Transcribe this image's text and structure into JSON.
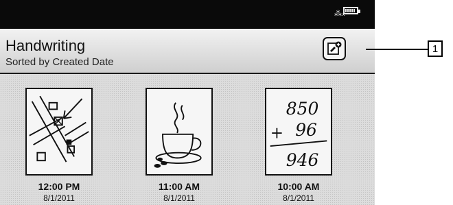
{
  "status_bar": {
    "wifi_icon": "wifi-off-icon",
    "battery_icon": "battery-icon"
  },
  "header": {
    "title": "Handwriting",
    "subtitle": "Sorted by Created Date",
    "new_note_icon": "new-handwriting-icon"
  },
  "callout": {
    "label": "1"
  },
  "notes": [
    {
      "time": "12:00 PM",
      "date": "8/1/2011",
      "thumbnail": "map-sketch"
    },
    {
      "time": "11:00 AM",
      "date": "8/1/2011",
      "thumbnail": "coffee-cup-sketch"
    },
    {
      "time": "10:00 AM",
      "date": "8/1/2011",
      "thumbnail": "math-sum-sketch",
      "sketch_text": [
        "850",
        "+",
        "96",
        "946"
      ]
    }
  ]
}
